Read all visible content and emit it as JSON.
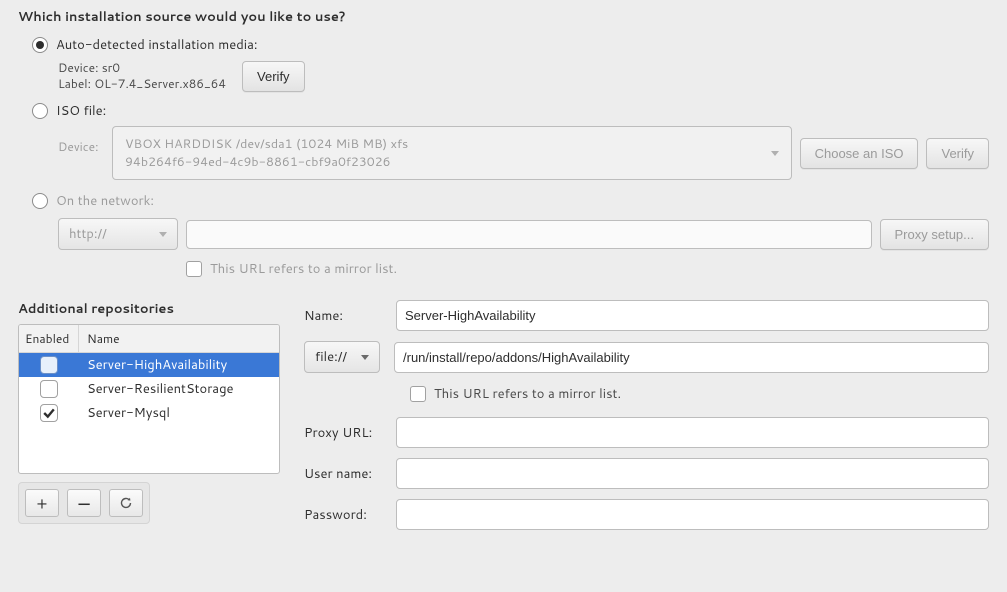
{
  "heading": "Which installation source would you like to use?",
  "source": {
    "auto": {
      "label": "Auto-detected installation media:",
      "device_label": "Device: sr0",
      "label_label": "Label: OL-7.4_Server.x86_64",
      "verify": "Verify"
    },
    "iso": {
      "label": "ISO file:",
      "device_label": "Device:",
      "device_value_line1": "VBOX HARDDISK /dev/sda1 (1024 MiB MB) xfs",
      "device_value_line2": "94b264f6-94ed-4c9b-8861-cbf9a0f23026",
      "choose": "Choose an ISO",
      "verify": "Verify"
    },
    "network": {
      "label": "On the network:",
      "scheme": "http://",
      "url": "",
      "proxy": "Proxy setup...",
      "mirror_label": "This URL refers to a mirror list."
    }
  },
  "repos": {
    "heading": "Additional repositories",
    "cols": {
      "enabled": "Enabled",
      "name": "Name"
    },
    "items": [
      {
        "enabled": false,
        "name": "Server-HighAvailability",
        "selected": true
      },
      {
        "enabled": false,
        "name": "Server-ResilientStorage",
        "selected": false
      },
      {
        "enabled": true,
        "name": "Server-Mysql",
        "selected": false
      }
    ],
    "toolbar": {
      "add": "+",
      "remove": "−",
      "refresh": "↻"
    }
  },
  "repoform": {
    "name_label": "Name:",
    "name_value": "Server-HighAvailability",
    "scheme": "file://",
    "path_value": "/run/install/repo/addons/HighAvailability",
    "mirror_label": "This URL refers to a mirror list.",
    "proxyurl_label": "Proxy URL:",
    "username_label": "User name:",
    "password_label": "Password:"
  }
}
